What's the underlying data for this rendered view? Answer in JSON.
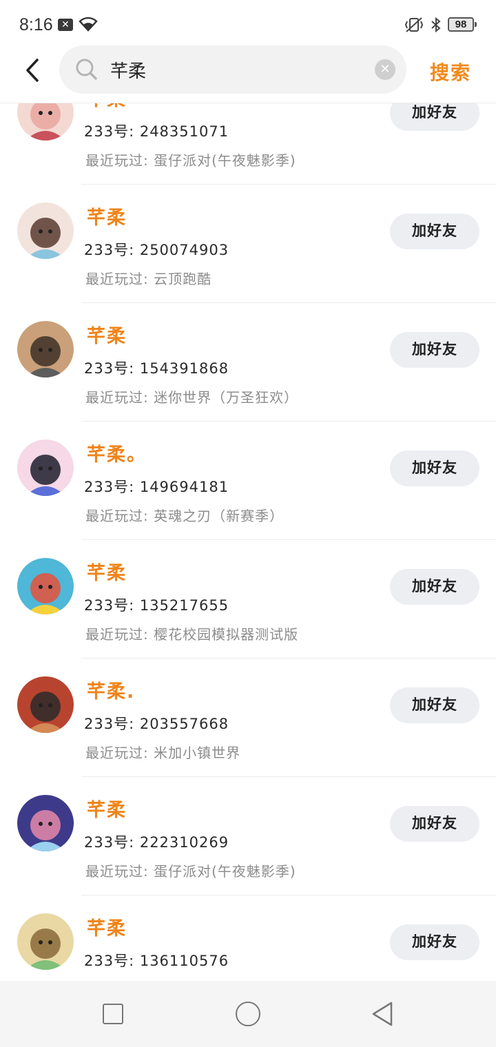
{
  "status_bar": {
    "time": "8:16",
    "battery": "98"
  },
  "header": {
    "search_value": "芊柔",
    "search_button": "搜索"
  },
  "results": [
    {
      "name": "芊柔",
      "uid": "233号: 248351071",
      "played": "最近玩过: 蛋仔派对(午夜魅影季)",
      "button": "加好友",
      "avatar_colors": [
        "#f3d9d2",
        "#e9a6a0",
        "#c9525c"
      ]
    },
    {
      "name": "芊柔",
      "uid": "233号: 250074903",
      "played": "最近玩过: 云顶跑酷",
      "button": "加好友",
      "avatar_colors": [
        "#f2e4dc",
        "#5a3b2f",
        "#8bc4df"
      ]
    },
    {
      "name": "芊柔",
      "uid": "233号: 154391868",
      "played": "最近玩过: 迷你世界（万圣狂欢）",
      "button": "加好友",
      "avatar_colors": [
        "#caa07a",
        "#3d3027",
        "#5d5d5d"
      ]
    },
    {
      "name": "芊柔。",
      "uid": "233号: 149694181",
      "played": "最近玩过: 英魂之刃（新赛季）",
      "button": "加好友",
      "avatar_colors": [
        "#f6d8e6",
        "#1e1e2e",
        "#5a6fd8"
      ]
    },
    {
      "name": "芊柔",
      "uid": "233号: 135217655",
      "played": "最近玩过: 樱花校园模拟器测试版",
      "button": "加好友",
      "avatar_colors": [
        "#4fb7d8",
        "#e6513a",
        "#f6d13b"
      ]
    },
    {
      "name": "芊柔.",
      "uid": "233号: 203557668",
      "played": "最近玩过: 米加小镇世界",
      "button": "加好友",
      "avatar_colors": [
        "#b8442f",
        "#2a2a2a",
        "#d48a55"
      ]
    },
    {
      "name": "芊柔",
      "uid": "233号: 222310269",
      "played": "最近玩过: 蛋仔派对(午夜魅影季)",
      "button": "加好友",
      "avatar_colors": [
        "#3e3a8a",
        "#e58aa8",
        "#9bd0f0"
      ]
    },
    {
      "name": "芊柔",
      "uid": "233号: 136110576",
      "played": "",
      "button": "加好友",
      "avatar_colors": [
        "#e9d8a4",
        "#8a6a3a",
        "#7fc07a"
      ]
    }
  ]
}
